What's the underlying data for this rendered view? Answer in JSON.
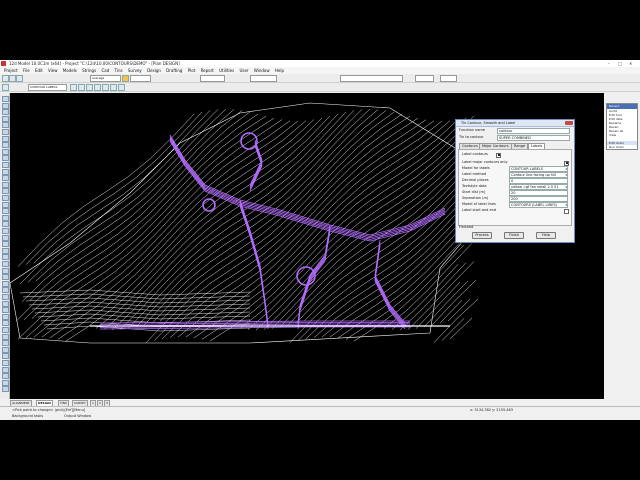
{
  "window": {
    "title": "12d Model 10.0C1m (x64) - Project \"C:\\12d\\10.00\\CONTOURS\\DEMO\" - [Plan DESIGN]",
    "controls": [
      "–",
      "□",
      "✕"
    ]
  },
  "menubar": [
    "Project",
    "File",
    "Edit",
    "View",
    "Models",
    "Strings",
    "Cad",
    "Tins",
    "Survey",
    "Design",
    "Drafting",
    "Plot",
    "Report",
    "Utilities",
    "User",
    "Window",
    "Help"
  ],
  "toolbar": {
    "linestyle": "average",
    "cell": "CONTOUR LABELS"
  },
  "canvas": {
    "background": "#000000",
    "contour_color": "#ffffff",
    "road_color": "#b36bff"
  },
  "right_menu": {
    "title": "Recent",
    "items": [
      "Audit",
      "Edit func",
      "Edit data",
      "Rename",
      "Recalc",
      "Recalc all",
      "View",
      "Edit chain",
      "Run chain"
    ]
  },
  "tabs": [
    "ALIGNMENT",
    "DESIGN",
    "TINS",
    "SURVEY",
    "1",
    "2",
    "3"
  ],
  "active_tab": "DESIGN",
  "status": {
    "prompt": "<Pick point to change> (pick)[Enf][Menu]",
    "bottom": "Background tasks",
    "output": "Output Window",
    "coords": "x: 3134.382  y: 2155.463"
  },
  "dialog": {
    "title": "Tin Contour, Smooth and Label",
    "function_name_label": "Function name",
    "function_name_value": "contour",
    "tin_label": "Tin to contour",
    "tin_value": "SUPER COMBINED",
    "tabs": [
      "Contours",
      "Major Contours",
      "Range",
      "Labels"
    ],
    "active_tab": "Labels",
    "label_contours_label": "Label contours",
    "label_major_only": "Label major contours only",
    "model_for_labels_label": "Model for labels",
    "model_for_labels_value": "CONTOUR LABELS",
    "label_method_label": "Label method",
    "label_method_value": "Contour line facing up hill",
    "decimal_places_label": "Decimal places",
    "decimal_places_value": "0",
    "textstyle_label": "Textstyle data",
    "textstyle_value": "yellow .rgf fan small 2.5 S1",
    "start_dist_label": "Start dist (m)",
    "start_dist_value": "20",
    "separation_label": "Separation (m)",
    "separation_value": "200",
    "label_lines_model_label": "Model of label lines",
    "label_lines_model_value": "CONTOURS (LABEL LINES)",
    "label_start_end": "Label start and end",
    "finished": "Finished",
    "buttons": [
      "Process",
      "Finish",
      "Help"
    ]
  }
}
